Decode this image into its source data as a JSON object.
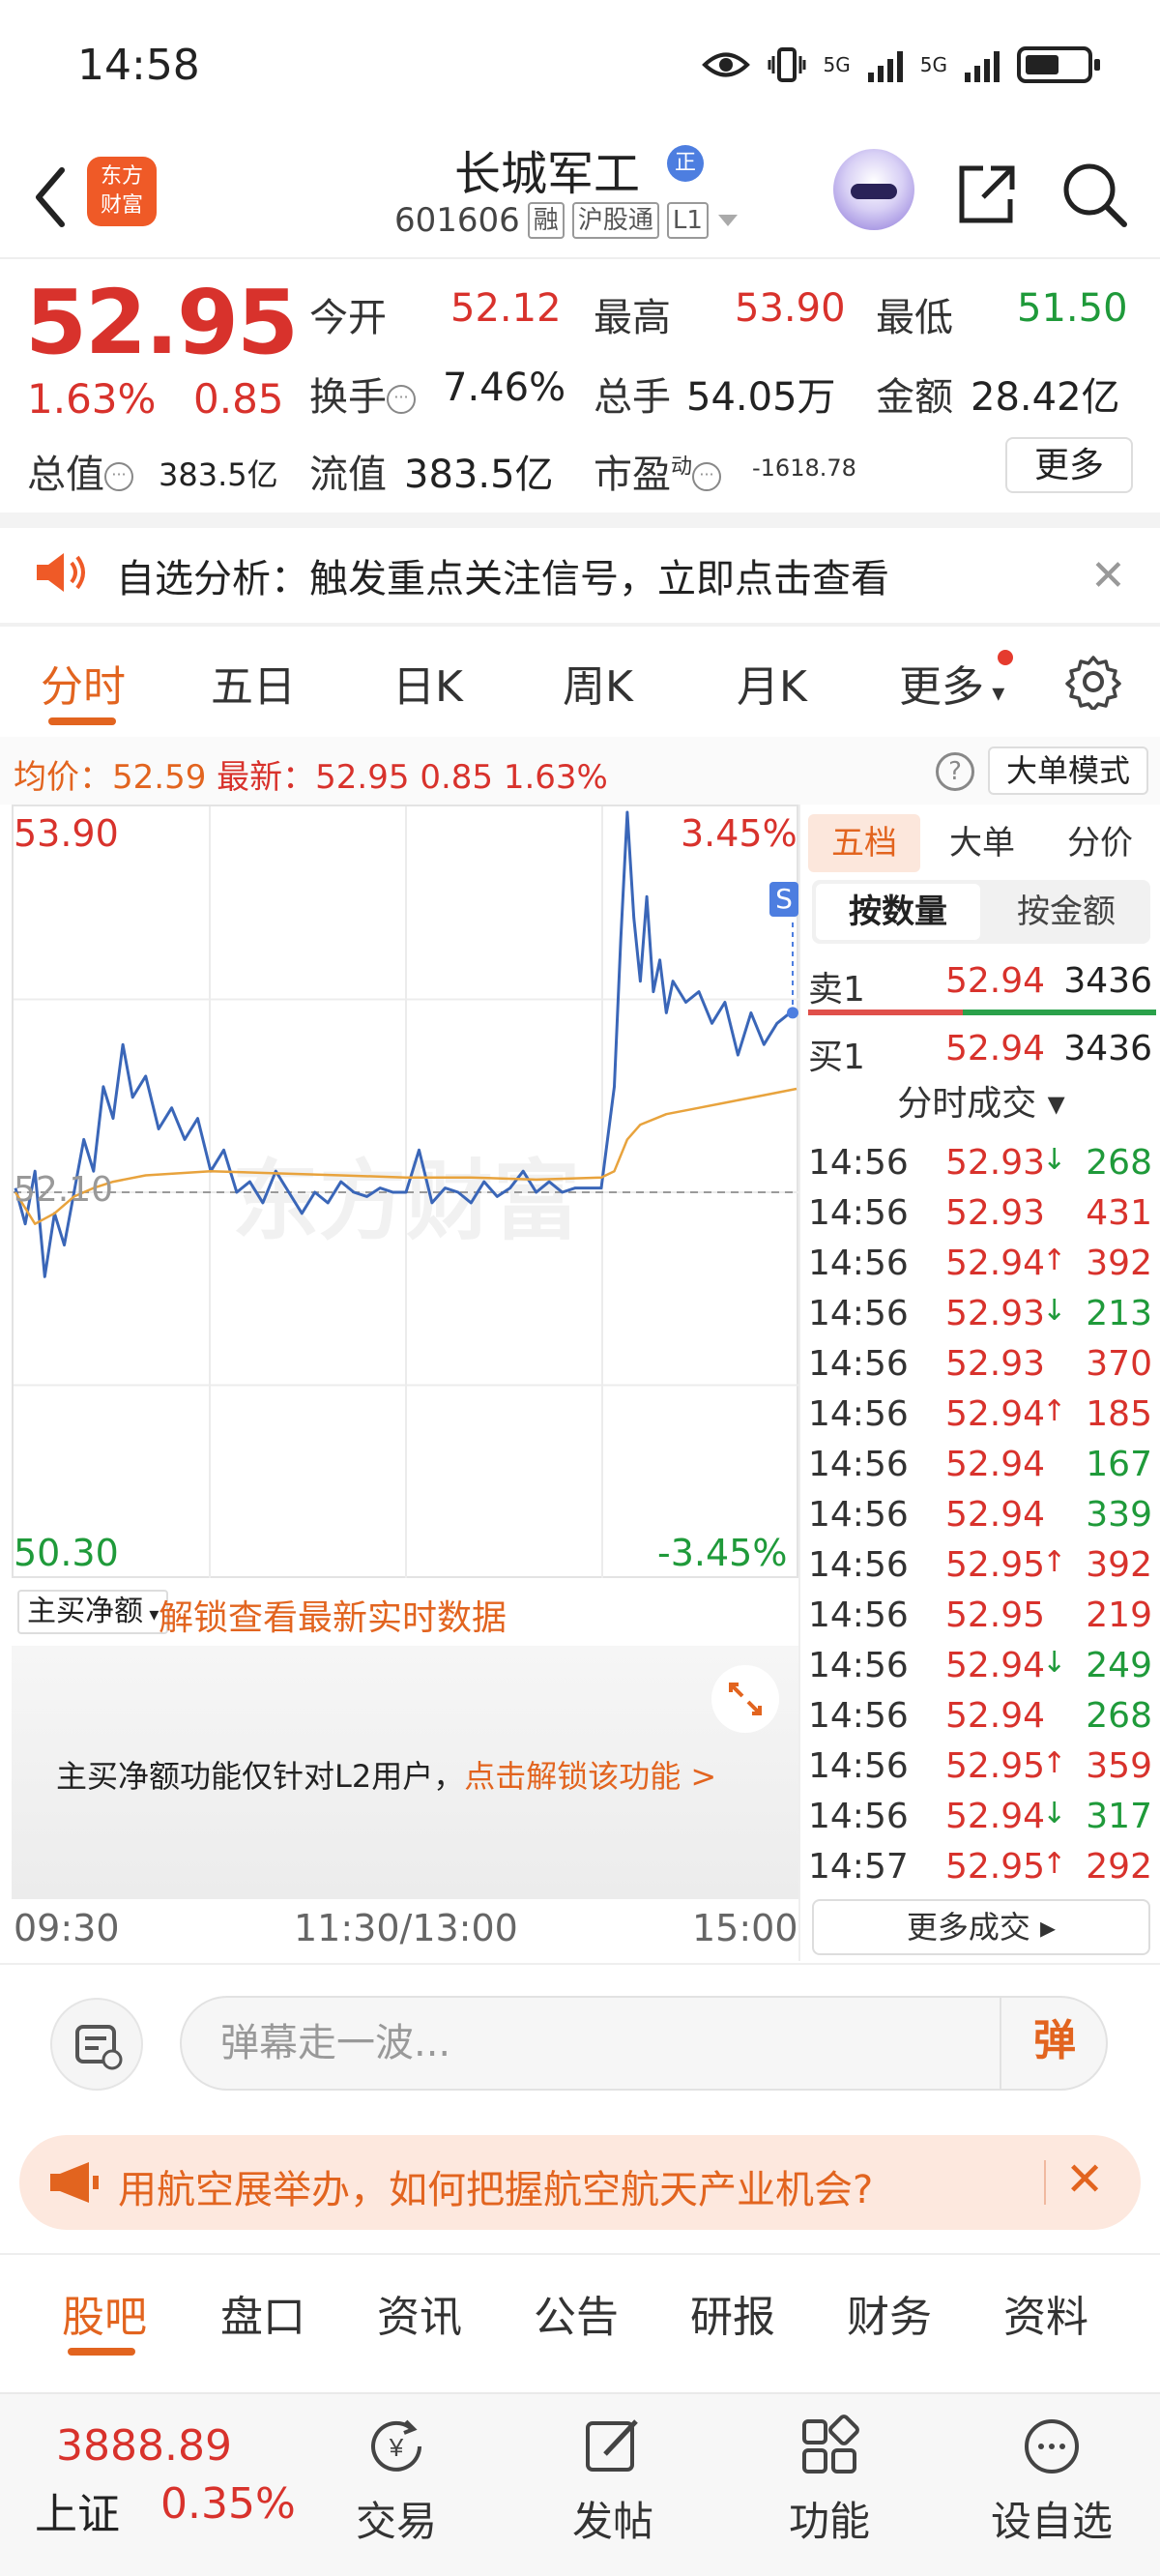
{
  "status_bar": {
    "time": "14:58",
    "network_1": "5G",
    "network_2": "5G",
    "battery_level": 0.55
  },
  "header": {
    "logo_text": "东方\n财富",
    "stock_name": "长城军工",
    "stock_code": "601606",
    "tags": [
      "融",
      "沪股通",
      "L1"
    ],
    "cert_badge": "正"
  },
  "quote": {
    "price": "52.95",
    "change_pct": "1.63%",
    "change": "0.85",
    "stats": [
      {
        "label": "今开",
        "value": "52.12",
        "color": "#d8322c"
      },
      {
        "label": "最高",
        "value": "53.90",
        "color": "#d8322c"
      },
      {
        "label": "最低",
        "value": "51.50",
        "color": "#1f9a3a"
      },
      {
        "label": "换手",
        "value": "7.46%",
        "color": "#222222"
      },
      {
        "label": "总手",
        "value": "54.05万",
        "color": "#222222"
      },
      {
        "label": "金额",
        "value": "28.42亿",
        "color": "#222222"
      },
      {
        "label": "总值",
        "value": "383.5亿",
        "color": "#222222"
      },
      {
        "label": "流值",
        "value": "383.5亿",
        "color": "#222222"
      },
      {
        "label": "市盈",
        "value": "-1618.78",
        "color": "#222222"
      }
    ],
    "pe_superscript": "动",
    "more_label": "更多"
  },
  "alert": {
    "text": "自选分析：触发重点关注信号，立即点击查看"
  },
  "chart_tabs": [
    "分时",
    "五日",
    "日K",
    "周K",
    "月K",
    "更多"
  ],
  "avg_row": {
    "avg_label": "均价：",
    "avg_value": "52.59",
    "latest_label": "最新：",
    "latest_value": "52.95",
    "latest_change": "0.85",
    "latest_pct": "1.63%",
    "mode_button": "大单模式"
  },
  "chart": {
    "high_label": "53.90",
    "up_pct_label": "3.45%",
    "low_label": "50.30",
    "down_pct_label": "-3.45%",
    "ref_label": "52.10",
    "badge": "S",
    "watermark": "东方财富",
    "time_labels": [
      "09:30",
      "11:30/13:00",
      "15:00"
    ]
  },
  "chart_data": {
    "type": "line",
    "xlabel": "",
    "ylabel": "",
    "ylim": [
      50.3,
      53.9
    ],
    "reference": 52.1,
    "xlim": [
      0,
      240
    ],
    "series": [
      {
        "name": "",
        "color": "#3a66b8",
        "x": [
          0,
          3,
          6,
          9,
          12,
          15,
          18,
          21,
          24,
          27,
          30,
          33,
          36,
          40,
          44,
          48,
          52,
          56,
          60,
          64,
          68,
          72,
          76,
          80,
          84,
          88,
          92,
          96,
          100,
          104,
          108,
          112,
          116,
          120,
          124,
          128,
          132,
          136,
          140,
          144,
          148,
          152,
          156,
          160,
          164,
          168,
          172,
          176,
          180,
          184,
          186,
          188,
          190,
          192,
          194,
          196,
          198,
          200,
          202,
          206,
          210,
          214,
          218,
          222,
          226,
          230,
          234,
          238,
          240
        ],
        "values": [
          52.12,
          51.95,
          52.2,
          51.7,
          52.0,
          51.85,
          52.1,
          52.35,
          52.2,
          52.6,
          52.45,
          52.8,
          52.55,
          52.65,
          52.4,
          52.5,
          52.35,
          52.45,
          52.2,
          52.3,
          52.1,
          52.15,
          52.05,
          52.2,
          52.1,
          52.0,
          52.1,
          52.05,
          52.15,
          52.1,
          52.08,
          52.12,
          52.1,
          52.1,
          52.3,
          52.05,
          52.12,
          52.1,
          52.05,
          52.15,
          52.08,
          52.12,
          52.2,
          52.1,
          52.15,
          52.1,
          52.12,
          52.12,
          52.12,
          52.6,
          53.3,
          53.9,
          53.4,
          53.1,
          53.5,
          53.05,
          53.2,
          52.95,
          53.1,
          53.0,
          53.05,
          52.9,
          53.0,
          52.75,
          52.95,
          52.8,
          52.9,
          52.95,
          52.95
        ]
      },
      {
        "name": "",
        "color": "#e8a33d",
        "x": [
          0,
          6,
          12,
          18,
          24,
          30,
          40,
          60,
          80,
          100,
          120,
          140,
          160,
          180,
          184,
          188,
          192,
          200,
          210,
          220,
          230,
          240
        ],
        "values": [
          52.1,
          51.95,
          52.0,
          52.08,
          52.12,
          52.15,
          52.18,
          52.2,
          52.19,
          52.18,
          52.17,
          52.17,
          52.16,
          52.17,
          52.2,
          52.35,
          52.42,
          52.47,
          52.5,
          52.53,
          52.56,
          52.59
        ]
      }
    ]
  },
  "netbuy": {
    "select_label": "主买净额",
    "unlock_link": "解锁查看最新实时数据",
    "notice": "主买净额功能仅针对L2用户，",
    "notice_link": "点击解锁该功能 >"
  },
  "order_book": {
    "tabs": [
      "五档",
      "大单",
      "分价"
    ],
    "toggle": [
      "按数量",
      "按金额"
    ],
    "rows": [
      {
        "label": "卖1",
        "price": "52.94",
        "volume": "3436"
      },
      {
        "label": "买1",
        "price": "52.94",
        "volume": "3436"
      }
    ],
    "ticks_header": "分时成交 ▾",
    "ticks": [
      {
        "time": "14:56",
        "price": "52.93",
        "arrow": "↓",
        "volume": "268",
        "dir": "down"
      },
      {
        "time": "14:56",
        "price": "52.93",
        "arrow": "",
        "volume": "431",
        "dir": "up"
      },
      {
        "time": "14:56",
        "price": "52.94",
        "arrow": "↑",
        "volume": "392",
        "dir": "up"
      },
      {
        "time": "14:56",
        "price": "52.93",
        "arrow": "↓",
        "volume": "213",
        "dir": "down"
      },
      {
        "time": "14:56",
        "price": "52.93",
        "arrow": "",
        "volume": "370",
        "dir": "up"
      },
      {
        "time": "14:56",
        "price": "52.94",
        "arrow": "↑",
        "volume": "185",
        "dir": "up"
      },
      {
        "time": "14:56",
        "price": "52.94",
        "arrow": "",
        "volume": "167",
        "dir": "down"
      },
      {
        "time": "14:56",
        "price": "52.94",
        "arrow": "",
        "volume": "339",
        "dir": "down"
      },
      {
        "time": "14:56",
        "price": "52.95",
        "arrow": "↑",
        "volume": "392",
        "dir": "up"
      },
      {
        "time": "14:56",
        "price": "52.95",
        "arrow": "",
        "volume": "219",
        "dir": "up"
      },
      {
        "time": "14:56",
        "price": "52.94",
        "arrow": "↓",
        "volume": "249",
        "dir": "down"
      },
      {
        "time": "14:56",
        "price": "52.94",
        "arrow": "",
        "volume": "268",
        "dir": "down"
      },
      {
        "time": "14:56",
        "price": "52.95",
        "arrow": "↑",
        "volume": "359",
        "dir": "up"
      },
      {
        "time": "14:56",
        "price": "52.94",
        "arrow": "↓",
        "volume": "317",
        "dir": "down"
      },
      {
        "time": "14:57",
        "price": "52.95",
        "arrow": "↑",
        "volume": "292",
        "dir": "up"
      }
    ],
    "more_trades": "更多成交 ▸"
  },
  "comment_bar": {
    "placeholder": "弹幕走一波...",
    "send_label": "弹"
  },
  "promo": {
    "text": "用航空展举办，如何把握航空航天产业机会?"
  },
  "bottom_tabs": [
    "股吧",
    "盘口",
    "资讯",
    "公告",
    "研报",
    "财务",
    "资料"
  ],
  "nav": {
    "index_value": "3888.89",
    "index_name": "上证",
    "index_pct": "0.35%",
    "items": [
      {
        "label": "交易",
        "icon": "trade-icon"
      },
      {
        "label": "发帖",
        "icon": "post-icon"
      },
      {
        "label": "功能",
        "icon": "grid-icon"
      },
      {
        "label": "设自选",
        "icon": "add-watchlist-icon"
      }
    ]
  },
  "colors": {
    "up": "#d8322c",
    "down": "#1f9a3a",
    "accent": "#e2641f"
  }
}
